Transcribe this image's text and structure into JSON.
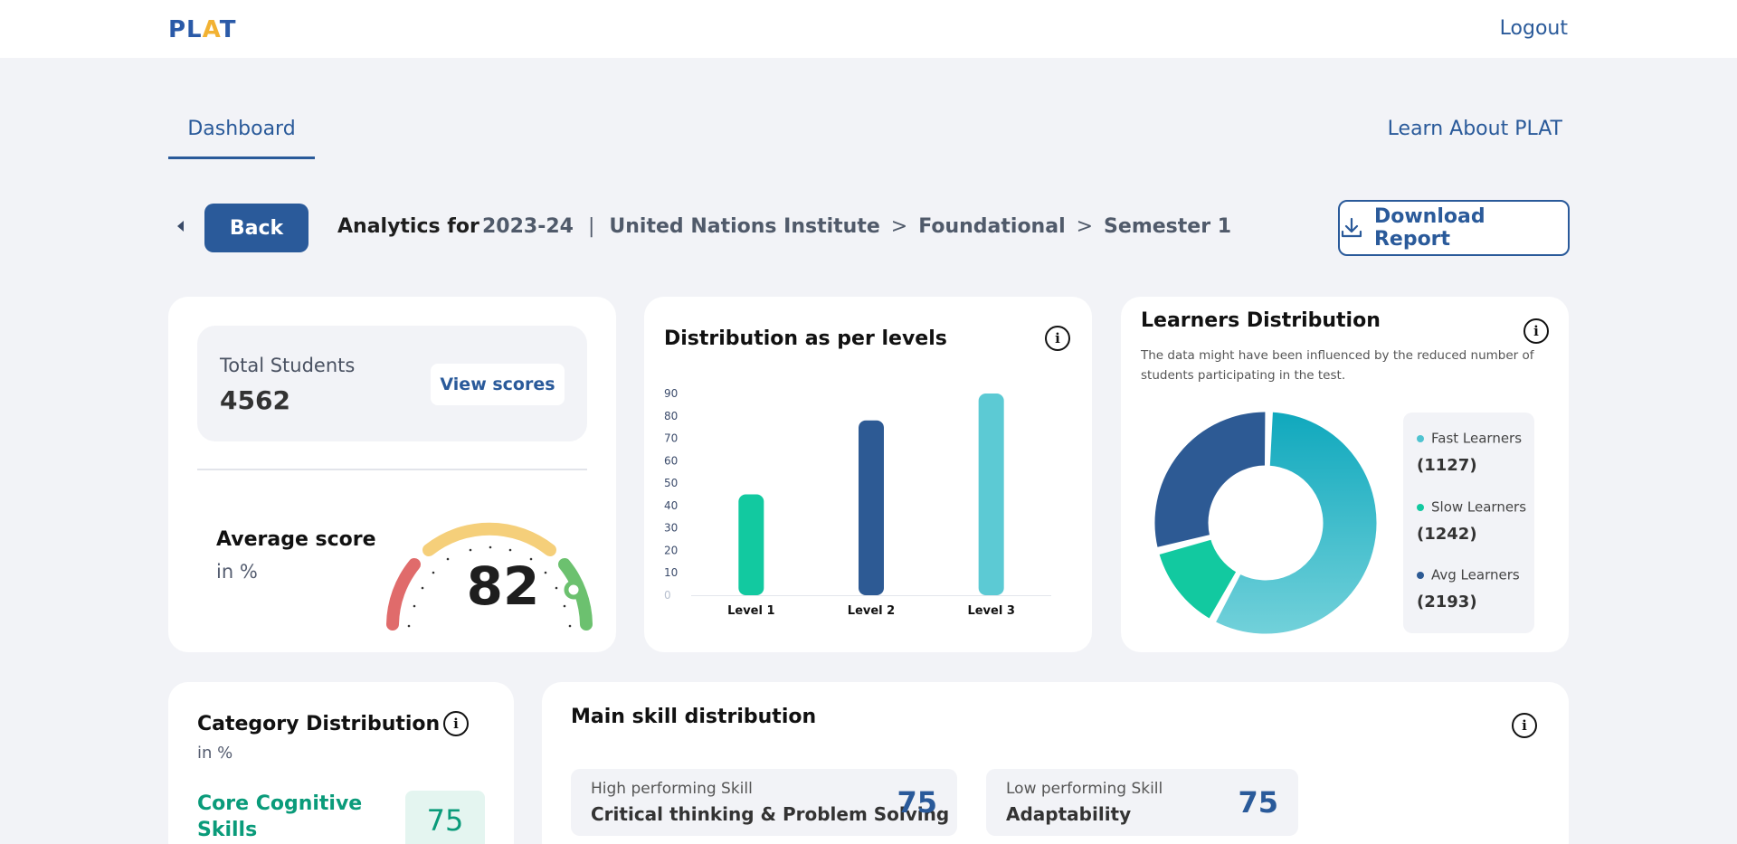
{
  "header": {
    "logo_text": "PLAT",
    "logout_label": "Logout"
  },
  "nav": {
    "tab_dashboard": "Dashboard",
    "learn_about": "Learn About PLAT"
  },
  "toolbar": {
    "back_label": "Back",
    "analytics_label": "Analytics for",
    "year": "2023-24",
    "separator": "|",
    "institute": "United Nations Institute",
    "level": "Foundational",
    "semester": "Semester 1",
    "chevron": ">",
    "download_label": "Download Report"
  },
  "summary": {
    "total_students_label": "Total Students",
    "total_students_value": "4562",
    "view_scores_label": "View scores",
    "avg_label": "Average score",
    "avg_unit": "in %",
    "avg_value": "82"
  },
  "levels_card": {
    "title": "Distribution as per levels",
    "info_symbol": "i"
  },
  "learners_card": {
    "title": "Learners Distribution",
    "info_symbol": "i",
    "note": "The data might have been influenced by the reduced number of students participating in the test.",
    "legend": [
      {
        "name": "Fast Learners",
        "count": "(1127)",
        "color": "#4fc3d0"
      },
      {
        "name": "Slow Learners",
        "count": "(1242)",
        "color": "#12c9a0"
      },
      {
        "name": "Avg Learners",
        "count": "(2193)",
        "color": "#2d5a94"
      }
    ]
  },
  "category_card": {
    "title": "Category Distribution",
    "info_symbol": "i",
    "unit": "in %",
    "item_name": "Core Cognitive Skills",
    "item_value": "75"
  },
  "skills_card": {
    "title": "Main skill distribution",
    "info_symbol": "i",
    "high_label": "High performing Skill",
    "high_name": "Critical thinking & Problem Solving",
    "high_value": "75",
    "low_label": "Low performing Skill",
    "low_name": "Adaptability",
    "low_value": "75"
  },
  "chart_data": [
    {
      "type": "bar",
      "title": "Distribution as per levels",
      "categories": [
        "Level 1",
        "Level 2",
        "Level 3"
      ],
      "values": [
        45,
        78,
        90
      ],
      "colors": [
        "#12c9a0",
        "#2d5a94",
        "#5ccad4"
      ],
      "yticks": [
        "0",
        "10",
        "20",
        "30",
        "40",
        "50",
        "60",
        "70",
        "80",
        "90"
      ],
      "ylim": [
        0,
        90
      ],
      "grid": false
    },
    {
      "type": "pie",
      "title": "Learners Distribution",
      "labels": [
        "Fast Learners",
        "Slow Learners",
        "Avg Learners"
      ],
      "values": [
        2193,
        496,
        1127
      ],
      "colors": [
        "#3ab6c6",
        "#12c9a0",
        "#2d5a94"
      ]
    }
  ]
}
